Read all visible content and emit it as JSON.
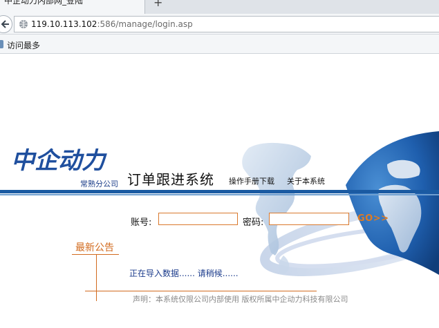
{
  "browser": {
    "tab_title": "中企动力内部网_登陆",
    "new_tab_symbol": "+",
    "url_host": "119.10.113.102",
    "url_rest": ":586/manage/login.asp",
    "bookmark_label": "访问最多"
  },
  "header": {
    "logo_text": "中企动力",
    "branch": "常熟分公司",
    "system_title": "订单跟进系统",
    "links": [
      "操作手册下载",
      "关于本系统"
    ]
  },
  "login": {
    "account_label": "账号:",
    "account_value": "",
    "password_label": "密码:",
    "password_value": "",
    "go_label": "GO>>"
  },
  "notice": {
    "title": "最新公告",
    "loading_text": "正在导入数据......  请稍候......"
  },
  "footer": {
    "text": "声明：本系统仅限公司内部使用  版权所属中企动力科技有限公司"
  },
  "colors": {
    "brand_blue": "#1a5aa2",
    "accent_orange": "#d26a1d",
    "input_border": "#d9782c"
  }
}
